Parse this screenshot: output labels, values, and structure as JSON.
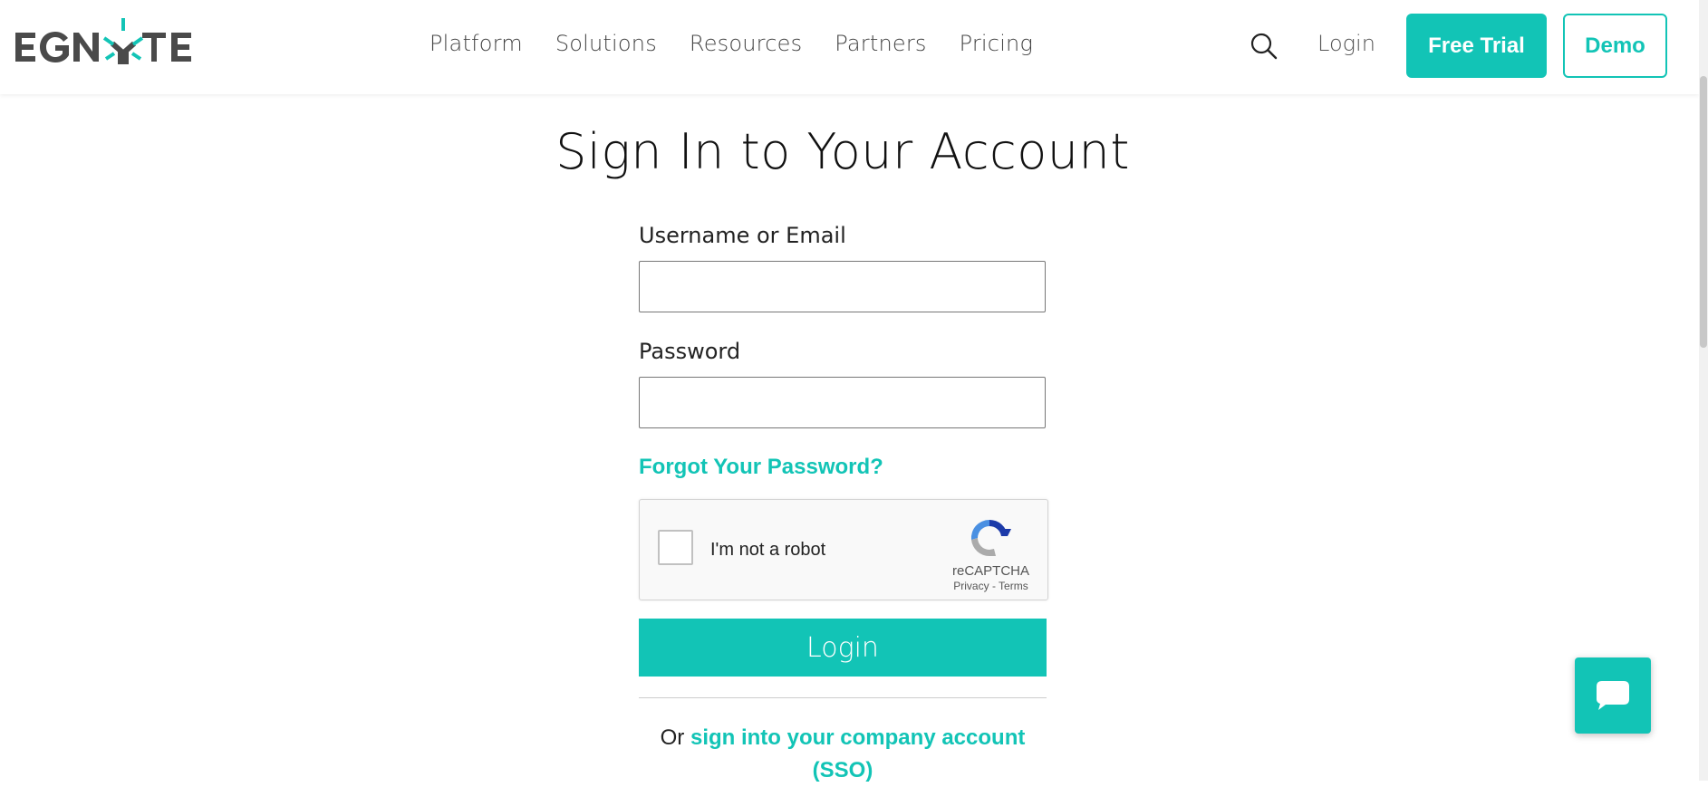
{
  "header": {
    "logo_text": "EGNYTE",
    "nav": [
      {
        "label": "Platform"
      },
      {
        "label": "Solutions"
      },
      {
        "label": "Resources"
      },
      {
        "label": "Partners"
      },
      {
        "label": "Pricing"
      }
    ],
    "login_label": "Login",
    "free_trial_label": "Free Trial",
    "demo_label": "Demo"
  },
  "main": {
    "title": "Sign In to Your Account",
    "username_label": "Username or Email",
    "username_value": "",
    "password_label": "Password",
    "password_value": "",
    "forgot_label": "Forgot Your Password?",
    "captcha": {
      "text": "I'm not a robot",
      "brand": "reCAPTCHA",
      "links": "Privacy - Terms"
    },
    "login_button": "Login",
    "sso_prefix": "Or ",
    "sso_link": "sign into your company account (SSO)"
  },
  "colors": {
    "accent": "#12c4b6",
    "logo_dark": "#4a4a4a"
  },
  "icons": [
    "search-icon",
    "chat-icon",
    "recaptcha-icon"
  ]
}
